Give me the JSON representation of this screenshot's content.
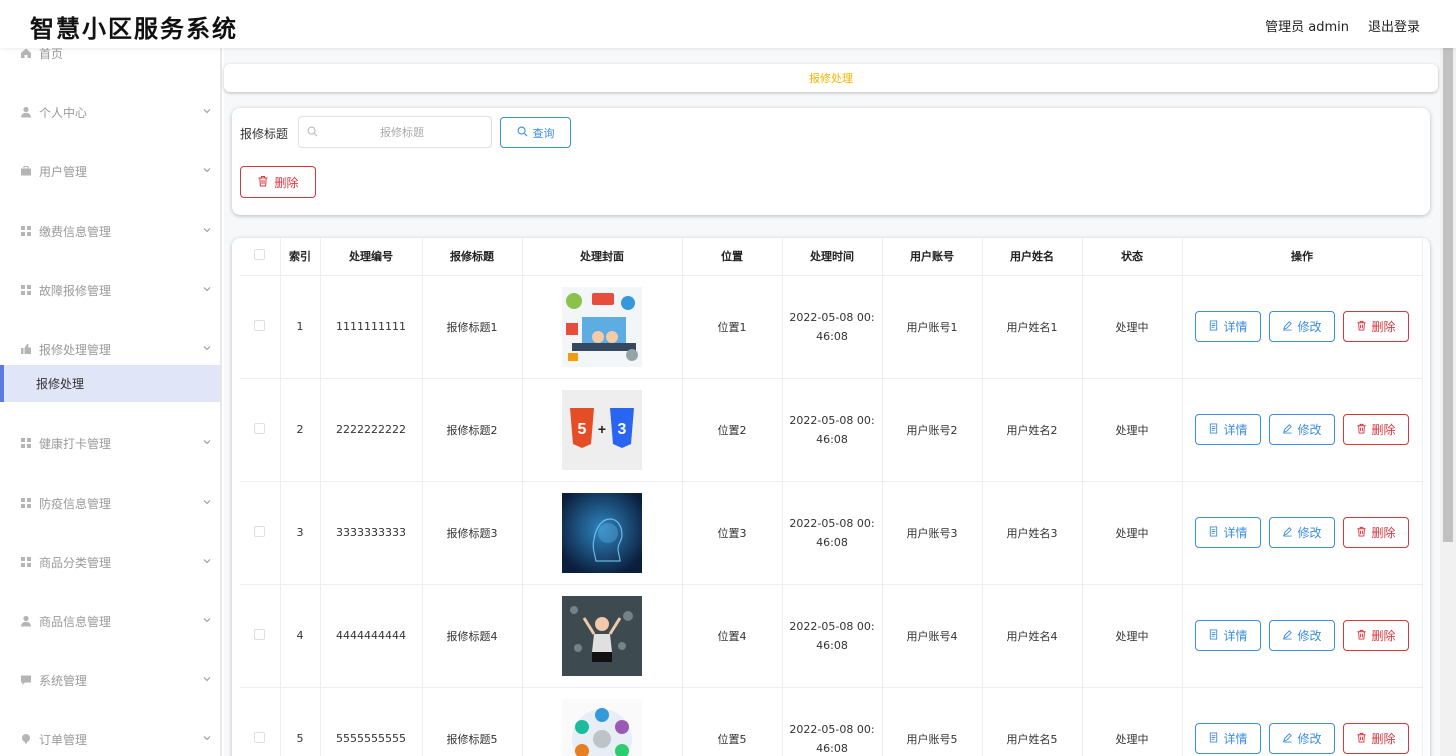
{
  "header": {
    "title": "智慧小区服务系统",
    "user": "管理员 admin",
    "logout": "退出登录"
  },
  "sidebar": {
    "items": [
      {
        "label": "首页",
        "icon": "home-icon",
        "top": 0
      },
      {
        "label": "个人中心",
        "icon": "user-icon"
      },
      {
        "label": "用户管理",
        "icon": "briefcase-icon"
      },
      {
        "label": "缴费信息管理",
        "icon": "grid-icon"
      },
      {
        "label": "故障报修管理",
        "icon": "grid-icon"
      },
      {
        "label": "报修处理管理",
        "icon": "thumb-icon"
      },
      {
        "label": "健康打卡管理",
        "icon": "grid-icon"
      },
      {
        "label": "防疫信息管理",
        "icon": "grid-icon"
      },
      {
        "label": "商品分类管理",
        "icon": "grid-icon"
      },
      {
        "label": "商品信息管理",
        "icon": "user-icon"
      },
      {
        "label": "系统管理",
        "icon": "chat-icon"
      },
      {
        "label": "订单管理",
        "icon": "pin-icon"
      }
    ],
    "active_sub": "报修处理"
  },
  "breadcrumb": "报修处理",
  "search": {
    "label": "报修标题",
    "placeholder": "报修标题",
    "query_button": "查询",
    "delete_button": "删除"
  },
  "table": {
    "headers": [
      "",
      "索引",
      "处理编号",
      "报修标题",
      "处理封面",
      "位置",
      "处理时间",
      "用户账号",
      "用户姓名",
      "状态",
      "操作"
    ],
    "rows": [
      {
        "index": "1",
        "number": "1111111111",
        "title": "报修标题1",
        "location": "位置1",
        "time_date": "2022-05-08 00:",
        "time_rest": "46:08",
        "account": "用户账号1",
        "name": "用户姓名1",
        "status": "处理中"
      },
      {
        "index": "2",
        "number": "2222222222",
        "title": "报修标题2",
        "location": "位置2",
        "time_date": "2022-05-08 00:",
        "time_rest": "46:08",
        "account": "用户账号2",
        "name": "用户姓名2",
        "status": "处理中"
      },
      {
        "index": "3",
        "number": "3333333333",
        "title": "报修标题3",
        "location": "位置3",
        "time_date": "2022-05-08 00:",
        "time_rest": "46:08",
        "account": "用户账号3",
        "name": "用户姓名3",
        "status": "处理中"
      },
      {
        "index": "4",
        "number": "4444444444",
        "title": "报修标题4",
        "location": "位置4",
        "time_date": "2022-05-08 00:",
        "time_rest": "46:08",
        "account": "用户账号4",
        "name": "用户姓名4",
        "status": "处理中"
      },
      {
        "index": "5",
        "number": "5555555555",
        "title": "报修标题5",
        "location": "位置5",
        "time_date": "2022-05-08 00:",
        "time_rest": "46:08",
        "account": "用户账号5",
        "name": "用户姓名5",
        "status": "处理中"
      }
    ],
    "actions": {
      "detail": "详情",
      "edit": "修改",
      "delete": "删除"
    }
  },
  "colors": {
    "accent": "#3c8ee0",
    "danger": "#d9363e",
    "breadcrumb": "#f0b400",
    "active_bg": "#e0e6f7"
  }
}
